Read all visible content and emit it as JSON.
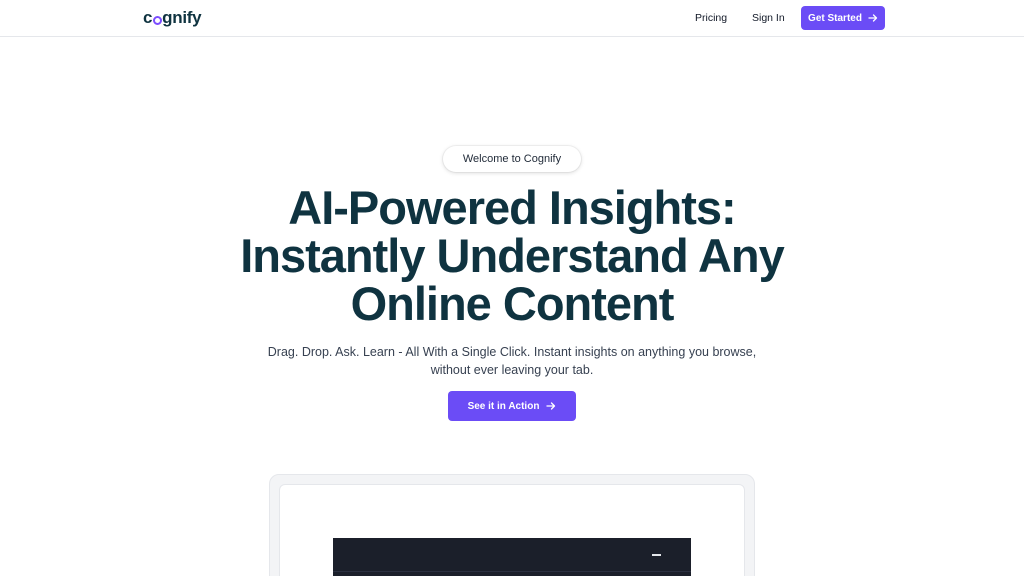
{
  "brand": {
    "logo_prefix": "c",
    "logo_suffix": "gnify",
    "accent_color": "#6b4cf6",
    "text_color": "#0f3340"
  },
  "nav": {
    "pricing": "Pricing",
    "sign_in": "Sign In",
    "get_started": "Get Started",
    "get_started_icon": "arrow-right-icon"
  },
  "hero": {
    "badge": "Welcome to Cognify",
    "title_line1": "AI-Powered Insights:",
    "title_line2": "Instantly Understand Any",
    "title_line3": "Online Content",
    "subtitle_line1": "Drag. Drop. Ask. Learn - All With a Single Click. Instant insights on anything you browse,",
    "subtitle_line2": "without ever leaving your tab.",
    "cta": "See it in Action",
    "cta_icon": "arrow-right-icon"
  },
  "demo": {
    "window_control_icon": "minimize-icon"
  }
}
